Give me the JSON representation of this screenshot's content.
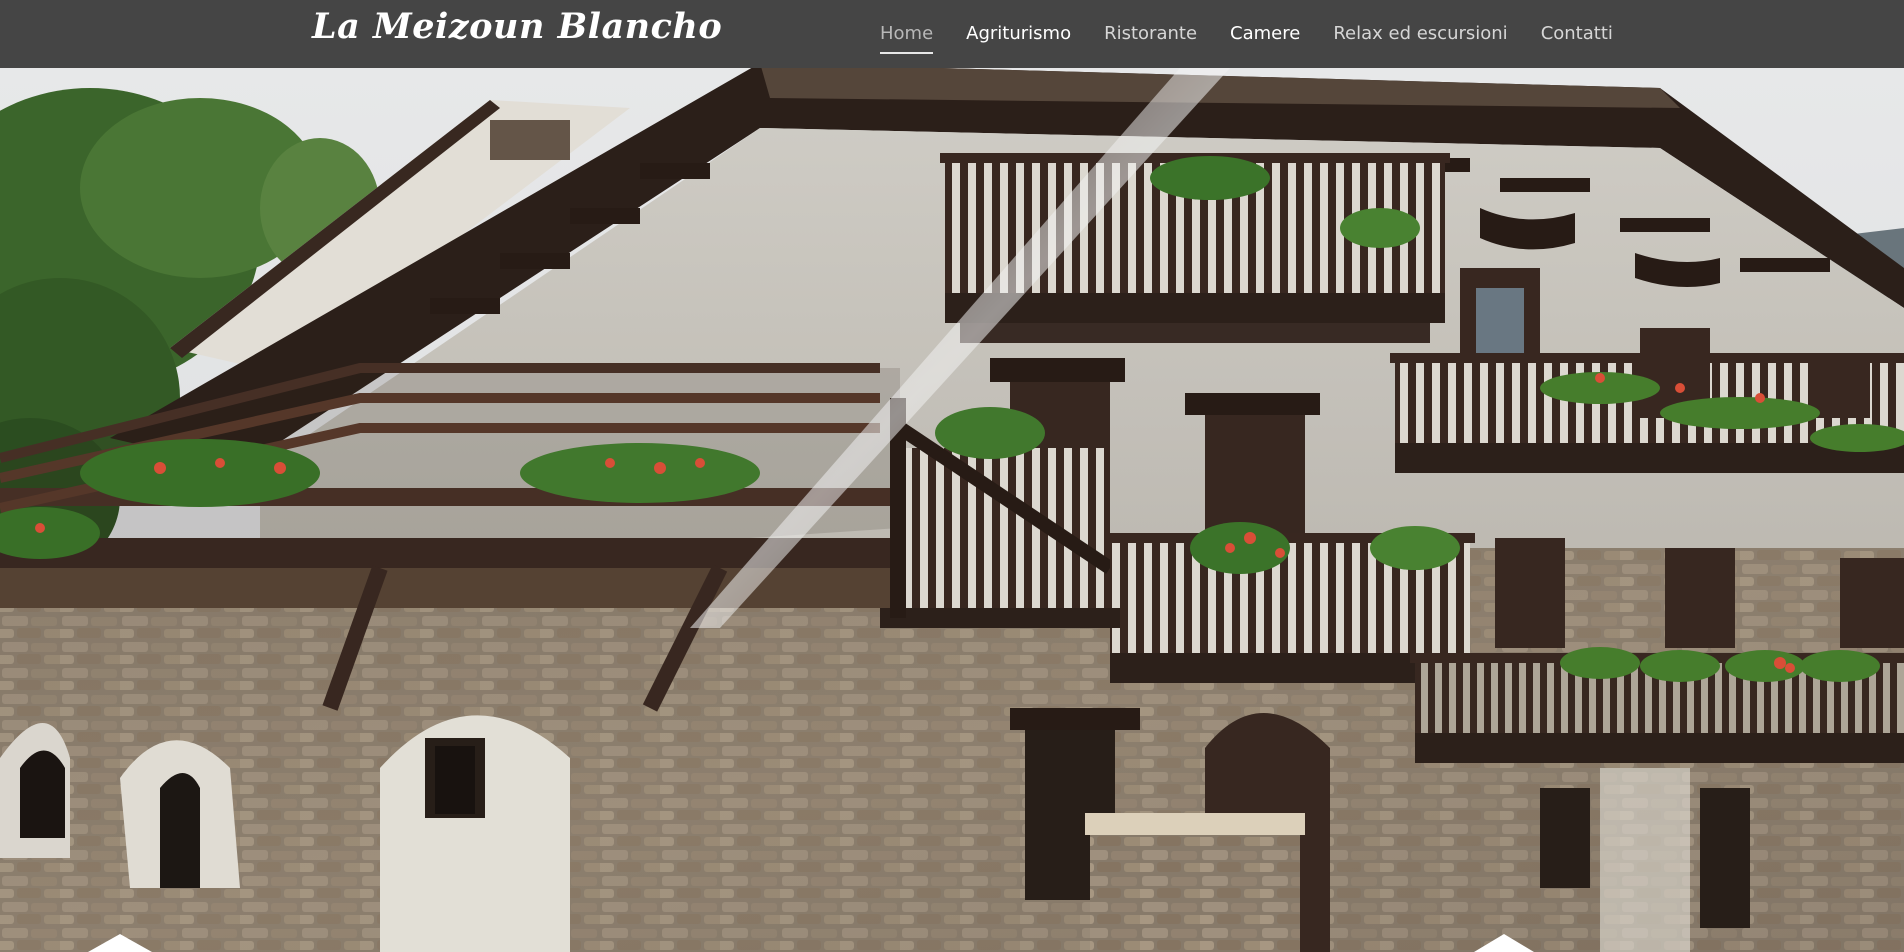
{
  "header": {
    "logo": "La Meizoun Blancho"
  },
  "nav": {
    "items": [
      {
        "label": "Home",
        "active": true
      },
      {
        "label": "Agriturismo",
        "active": false
      },
      {
        "label": "Ristorante",
        "active": false
      },
      {
        "label": "Camere",
        "active": false
      },
      {
        "label": "Relax ed escursioni",
        "active": false
      },
      {
        "label": "Contatti",
        "active": false
      }
    ]
  },
  "hero": {
    "image": "chalet-photo",
    "slider_prev_icon": "chevron-up-icon",
    "slider_next_icon": "chevron-up-icon"
  },
  "colors": {
    "navbar_bg": "#454545",
    "nav_text": "#d6d6d6",
    "nav_active": "#b8b8b8"
  }
}
